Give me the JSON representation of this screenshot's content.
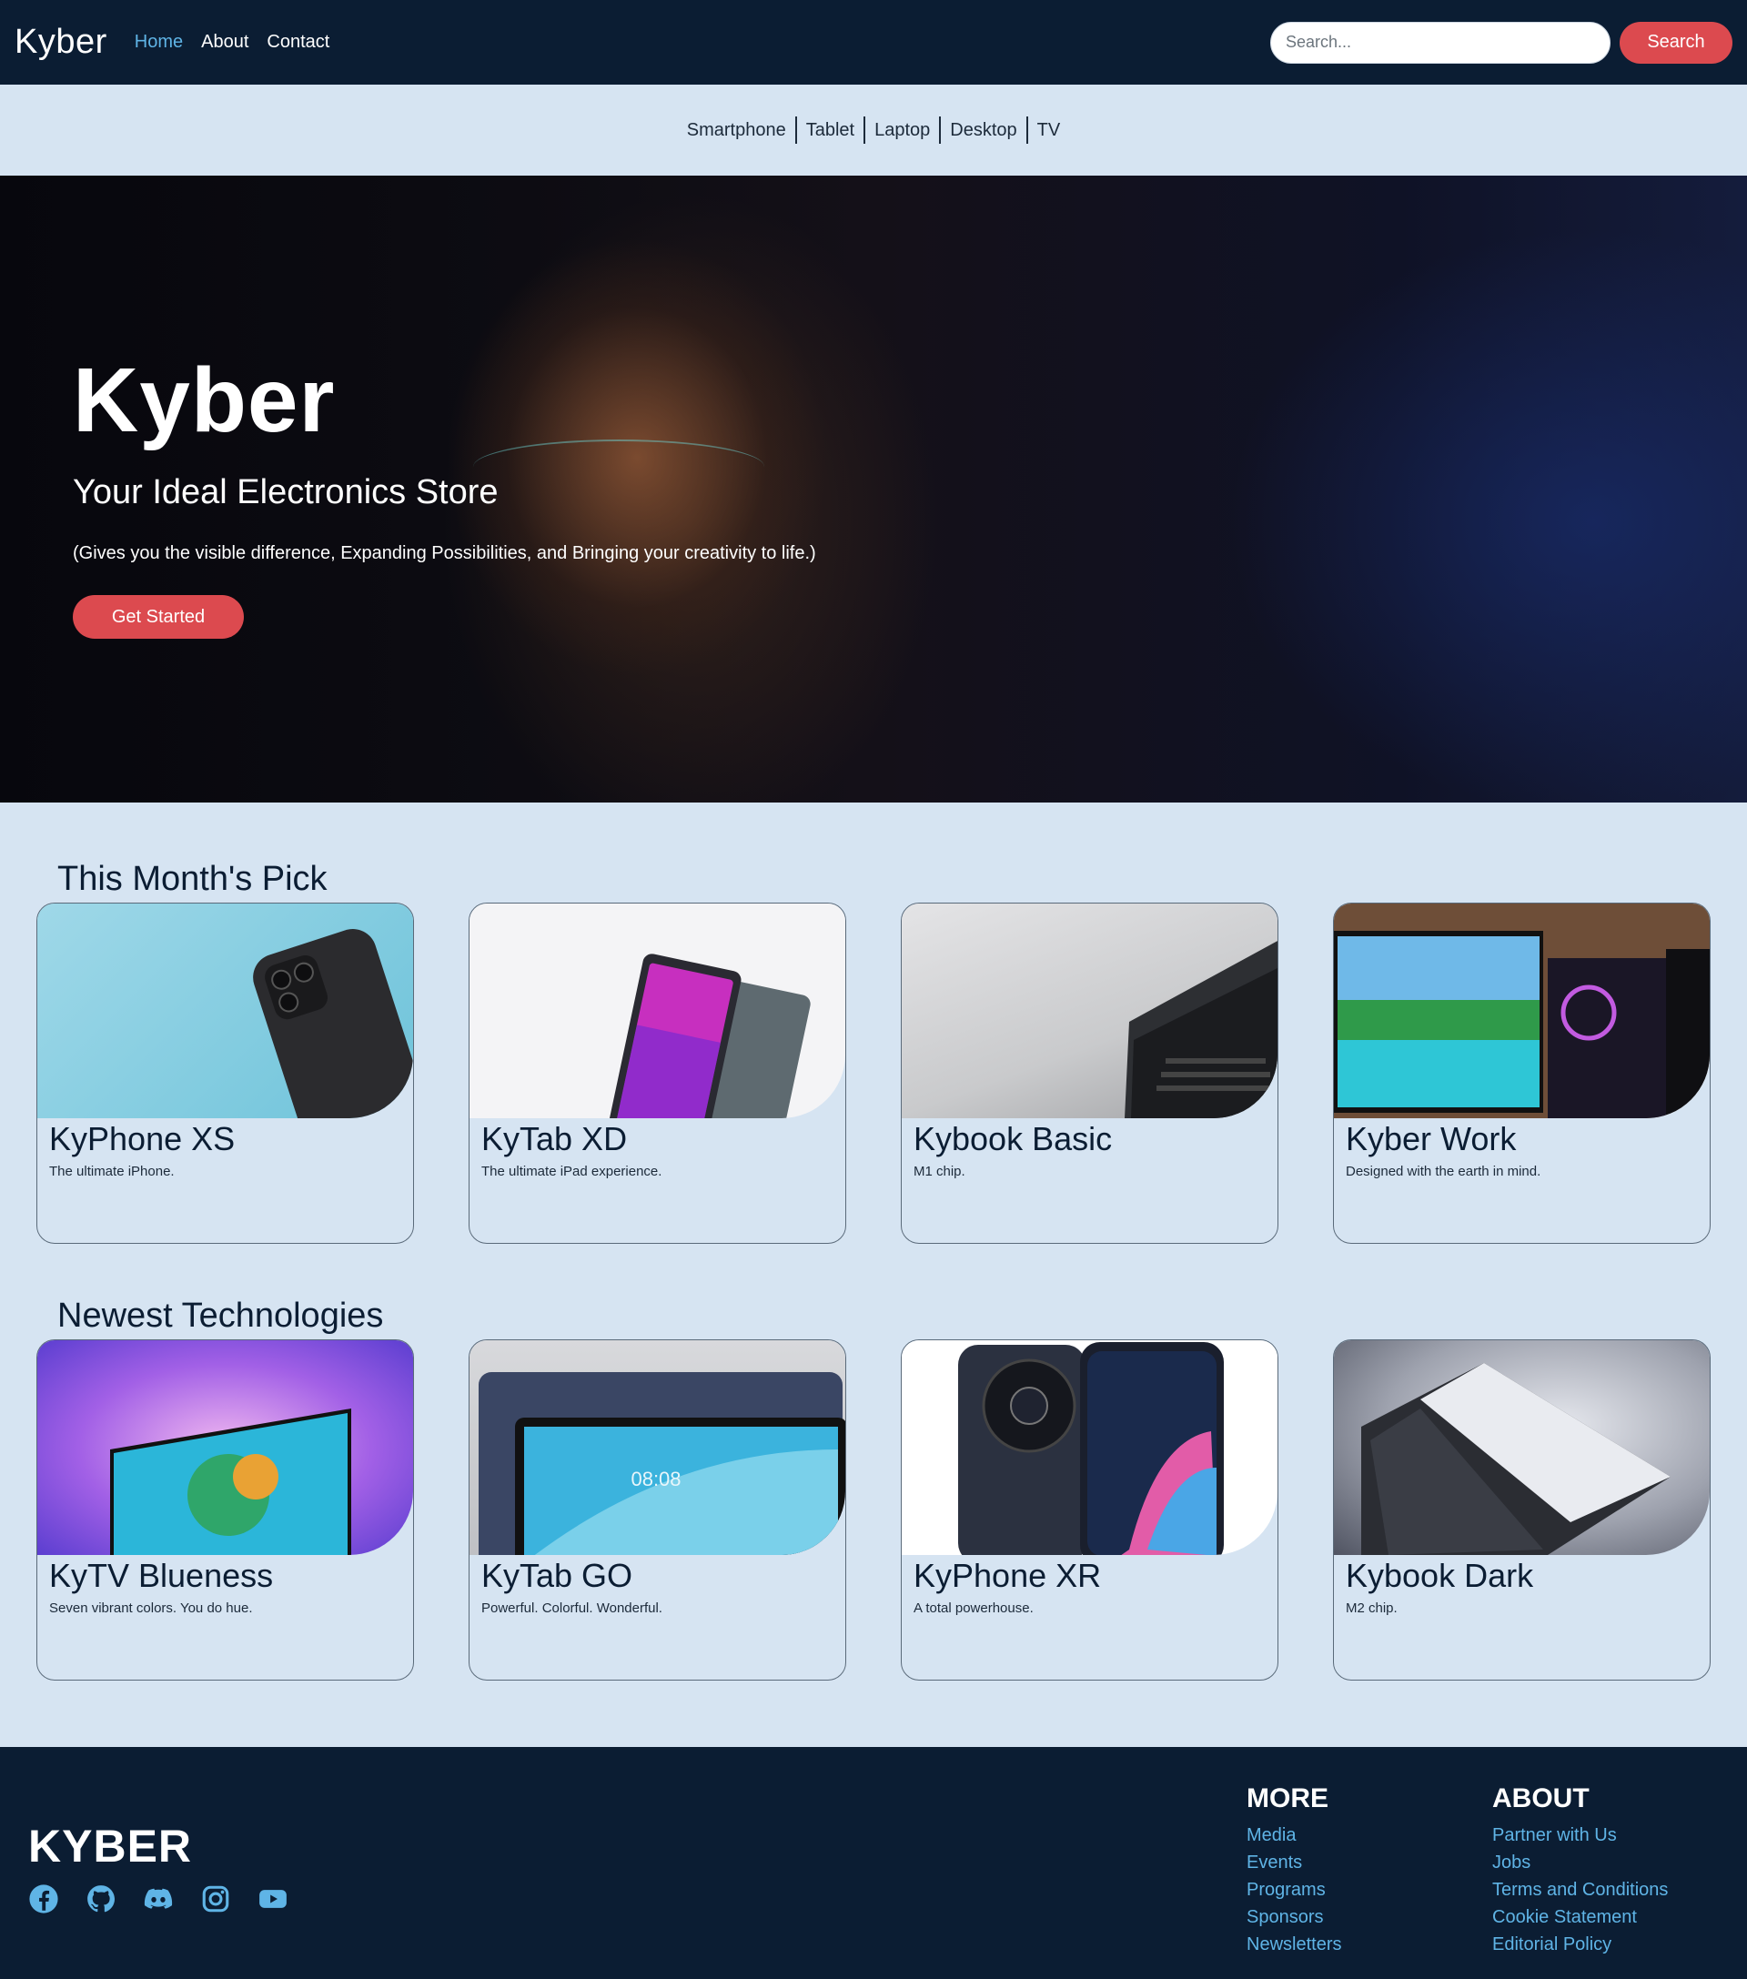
{
  "nav": {
    "brand": "Kyber",
    "links": [
      "Home",
      "About",
      "Contact"
    ],
    "search_placeholder": "Search...",
    "search_button": "Search"
  },
  "categories": [
    "Smartphone",
    "Tablet",
    "Laptop",
    "Desktop",
    "TV"
  ],
  "hero": {
    "title": "Kyber",
    "subtitle": "Your Ideal Electronics Store",
    "description": "(Gives you the visible difference, Expanding Possibilities, and Bringing your creativity to life.)",
    "button": "Get Started"
  },
  "monthly_pick": {
    "title": "This Month's Pick",
    "cards": [
      {
        "name": "KyPhone XS",
        "desc": "The ultimate iPhone."
      },
      {
        "name": "KyTab XD",
        "desc": "The ultimate iPad experience."
      },
      {
        "name": "Kybook Basic",
        "desc": "M1 chip."
      },
      {
        "name": "Kyber Work",
        "desc": "Designed with the earth in mind."
      }
    ]
  },
  "newest": {
    "title": "Newest Technologies",
    "cards": [
      {
        "name": "KyTV Blueness",
        "desc": "Seven vibrant colors. You do hue."
      },
      {
        "name": "KyTab GO",
        "desc": "Powerful. Colorful. Wonderful."
      },
      {
        "name": "KyPhone XR",
        "desc": "A total powerhouse."
      },
      {
        "name": "Kybook Dark",
        "desc": "M2 chip."
      }
    ]
  },
  "footer": {
    "brand": "KYBER",
    "socials": [
      "facebook-icon",
      "github-icon",
      "discord-icon",
      "instagram-icon",
      "youtube-icon"
    ],
    "more": {
      "title": "MORE",
      "links": [
        "Media",
        "Events",
        "Programs",
        "Sponsors",
        "Newsletters"
      ]
    },
    "about": {
      "title": "ABOUT",
      "links": [
        "Partner with Us",
        "Jobs",
        "Terms and Conditions",
        "Cookie Statement",
        "Editorial Policy"
      ]
    }
  },
  "colors": {
    "navy": "#0b1d33",
    "accent_red": "#dc4a4f",
    "link_blue": "#5fb4e6",
    "page_bg": "#d6e4f2"
  }
}
